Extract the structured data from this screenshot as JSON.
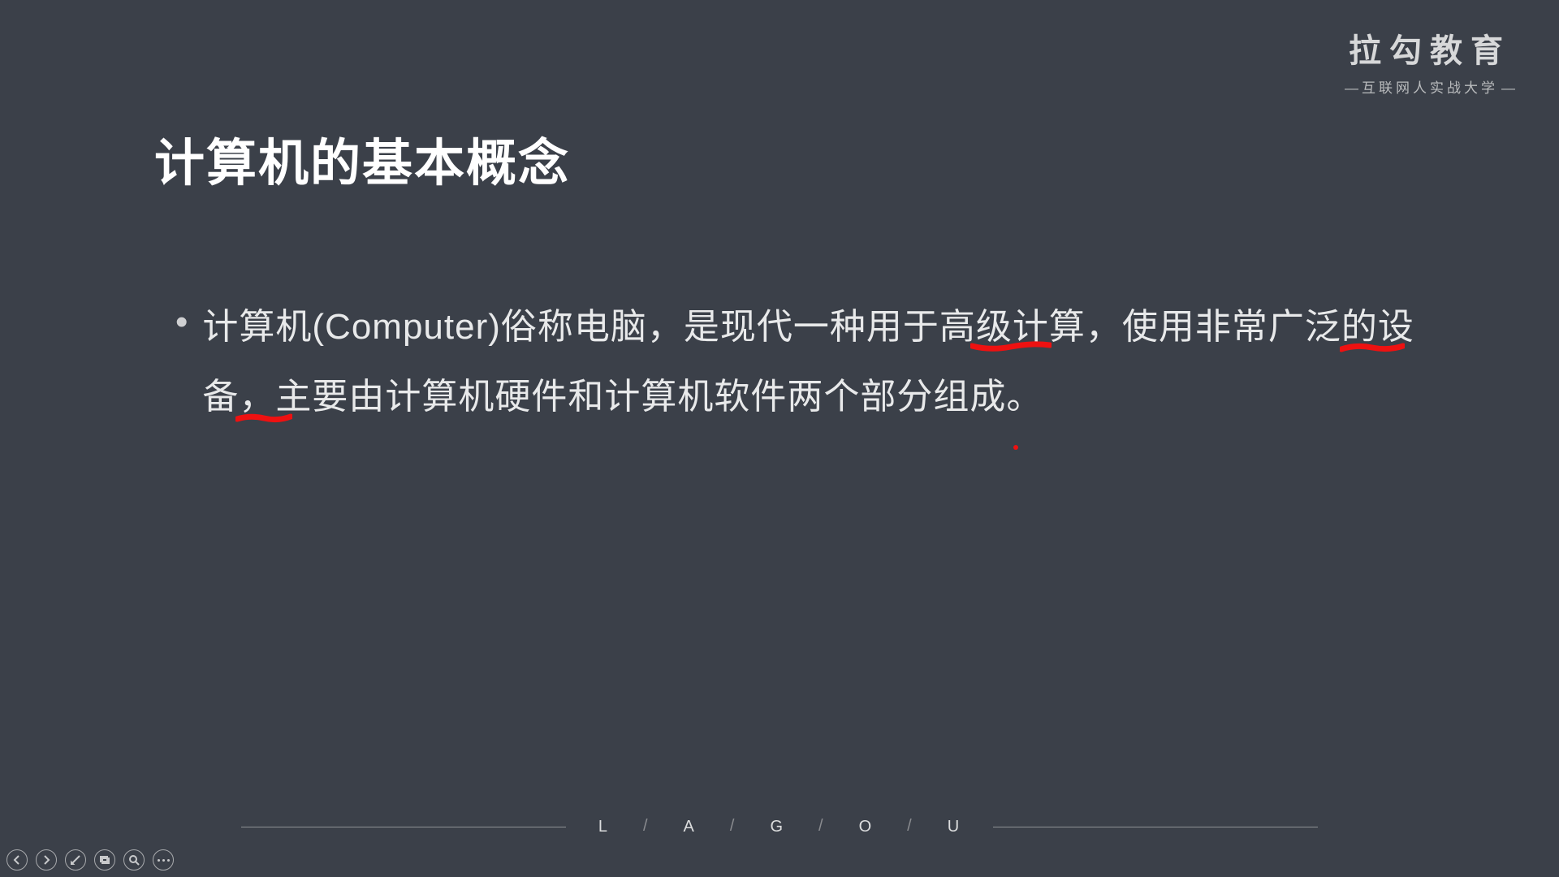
{
  "brand": {
    "title": "拉勾教育",
    "subtitle": "互联网人实战大学"
  },
  "slide": {
    "title": "计算机的基本概念",
    "bullet_text": "计算机(Computer)俗称电脑，是现代一种用于高级计算，使用非常广泛的设备，主要由计算机硬件和计算机软件两个部分组成。"
  },
  "footer": {
    "letters": [
      "L",
      "A",
      "G",
      "O",
      "U"
    ]
  },
  "annotation_color": "#e11"
}
